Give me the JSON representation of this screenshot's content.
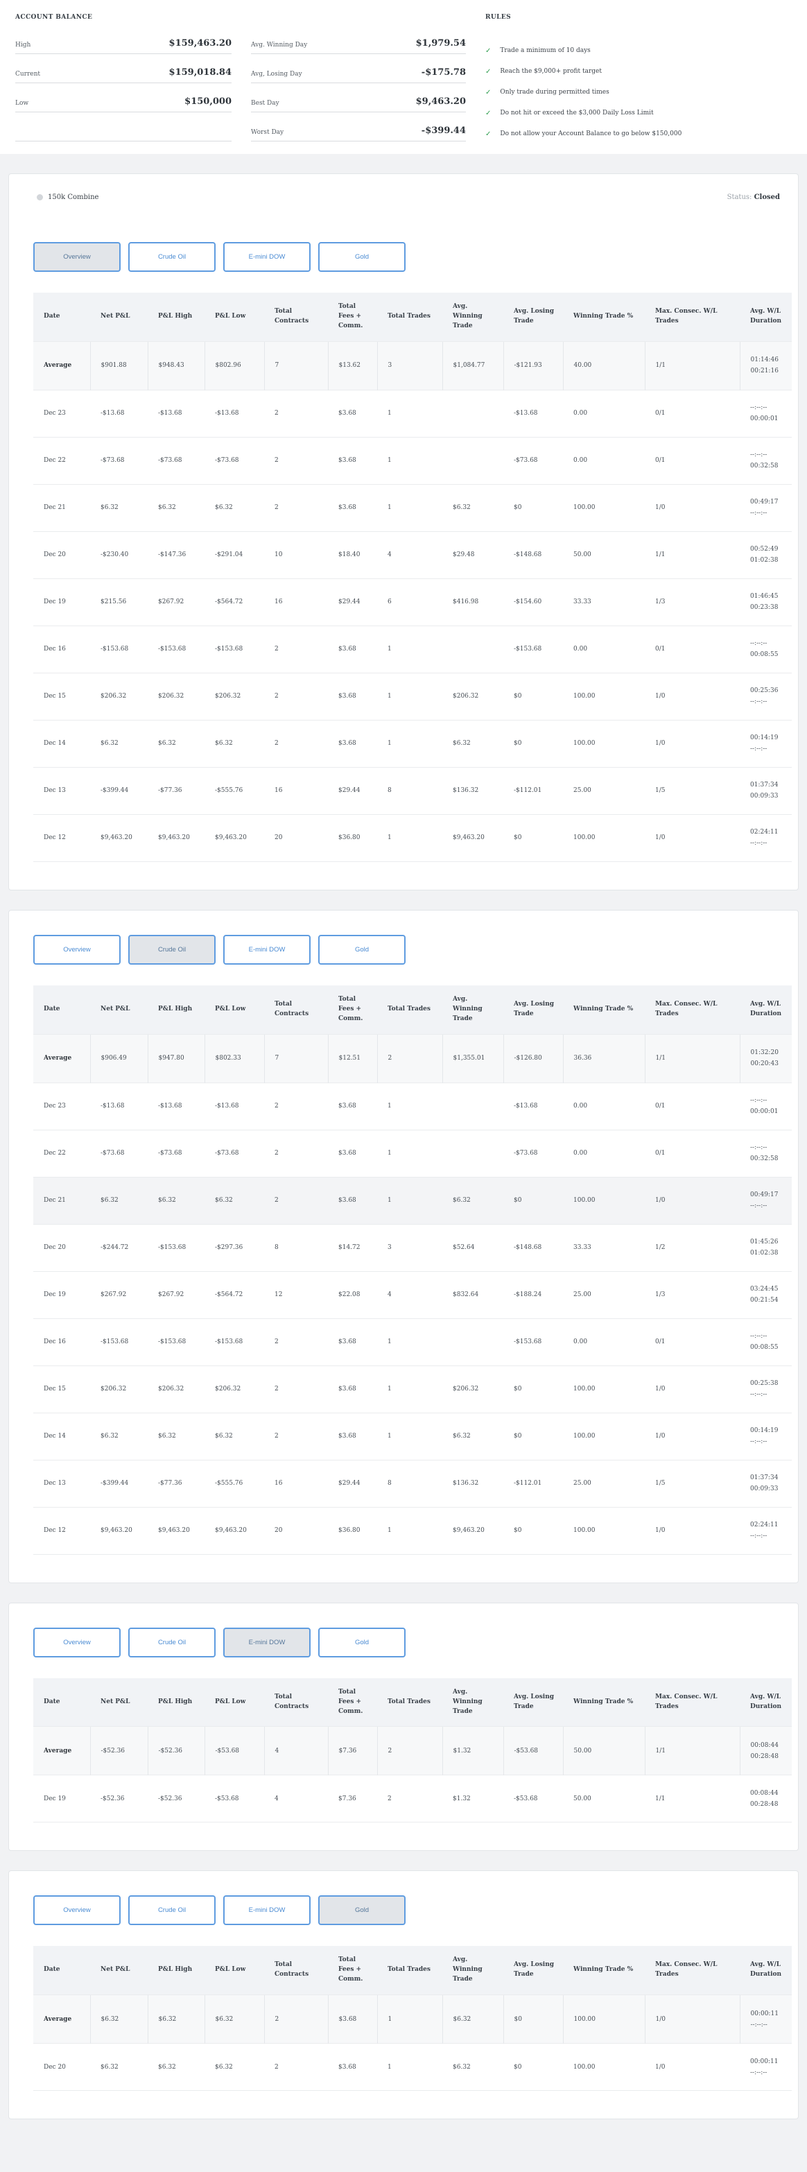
{
  "colors": {
    "accent_blue": "#5f9ce0",
    "check_green": "#2f9e4f",
    "header_bg": "#f1f3f6"
  },
  "icons": {
    "check": "✓",
    "status_dot": "gray-circle"
  },
  "top": {
    "account_balance": {
      "title": "ACCOUNT BALANCE",
      "rows": [
        {
          "label": "High",
          "value": "$159,463.20"
        },
        {
          "label": "Current",
          "value": "$159,018.84"
        },
        {
          "label": "Low",
          "value": "$150,000"
        },
        {
          "label": "",
          "value": ""
        }
      ]
    },
    "day_stats": [
      {
        "label": "Avg. Winning Day",
        "value": "$1,979.54"
      },
      {
        "label": "Avg, Losing Day",
        "value": "-$175.78"
      },
      {
        "label": "Best Day",
        "value": "$9,463.20"
      },
      {
        "label": "Worst Day",
        "value": "-$399.44"
      }
    ],
    "rules": {
      "title": "RULES",
      "items": [
        "Trade a minimum of 10 days",
        "Reach the $9,000+ profit target",
        "Only trade during permitted times",
        "Do not hit or exceed the $3,000 Daily Loss Limit",
        "Do not allow your Account Balance to go below $150,000"
      ]
    }
  },
  "shared": {
    "columns": [
      "Date",
      "Net P&L",
      "P&L High",
      "P&L Low",
      "Total Contracts",
      "Total Fees + Comm.",
      "Total Trades",
      "Avg. Winning Trade",
      "Avg. Losing Trade",
      "Winning Trade %",
      "Max. Consec. W/L Trades",
      "Avg. W/L Duration"
    ]
  },
  "cards": [
    {
      "header": {
        "title": "150k Combine",
        "status_label": "Status:",
        "status_value": "Closed"
      },
      "tabs": [
        {
          "label": "Overview",
          "active": true
        },
        {
          "label": "Crude Oil",
          "active": false
        },
        {
          "label": "E-mini DOW",
          "active": false
        },
        {
          "label": "Gold",
          "active": false
        }
      ],
      "rows": [
        {
          "is_avg": true,
          "date": "Average",
          "net": "$901.88",
          "high": "$948.43",
          "low": "$802.96",
          "contracts": "7",
          "fees": "$13.62",
          "trades": "3",
          "avg_win": "$1,084.77",
          "avg_loss": "-$121.93",
          "win_pct": "40.00",
          "consec": "1/1",
          "dur_win": "01:14:46",
          "dur_loss": "00:21:16"
        },
        {
          "date": "Dec 23",
          "net": "-$13.68",
          "high": "-$13.68",
          "low": "-$13.68",
          "contracts": "2",
          "fees": "$3.68",
          "trades": "1",
          "avg_win": "",
          "avg_loss": "-$13.68",
          "win_pct": "0.00",
          "consec": "0/1",
          "dur_win": "--:--:--",
          "dur_loss": "00:00:01"
        },
        {
          "date": "Dec 22",
          "net": "-$73.68",
          "high": "-$73.68",
          "low": "-$73.68",
          "contracts": "2",
          "fees": "$3.68",
          "trades": "1",
          "avg_win": "",
          "avg_loss": "-$73.68",
          "win_pct": "0.00",
          "consec": "0/1",
          "dur_win": "--:--:--",
          "dur_loss": "00:32:58"
        },
        {
          "date": "Dec 21",
          "net": "$6.32",
          "high": "$6.32",
          "low": "$6.32",
          "contracts": "2",
          "fees": "$3.68",
          "trades": "1",
          "avg_win": "$6.32",
          "avg_loss": "$0",
          "win_pct": "100.00",
          "consec": "1/0",
          "dur_win": "00:49:17",
          "dur_loss": "--:--:--"
        },
        {
          "date": "Dec 20",
          "net": "-$230.40",
          "high": "-$147.36",
          "low": "-$291.04",
          "contracts": "10",
          "fees": "$18.40",
          "trades": "4",
          "avg_win": "$29.48",
          "avg_loss": "-$148.68",
          "win_pct": "50.00",
          "consec": "1/1",
          "dur_win": "00:52:49",
          "dur_loss": "01:02:38"
        },
        {
          "date": "Dec 19",
          "net": "$215.56",
          "high": "$267.92",
          "low": "-$564.72",
          "contracts": "16",
          "fees": "$29.44",
          "trades": "6",
          "avg_win": "$416.98",
          "avg_loss": "-$154.60",
          "win_pct": "33.33",
          "consec": "1/3",
          "dur_win": "01:46:45",
          "dur_loss": "00:23:38"
        },
        {
          "date": "Dec 16",
          "net": "-$153.68",
          "high": "-$153.68",
          "low": "-$153.68",
          "contracts": "2",
          "fees": "$3.68",
          "trades": "1",
          "avg_win": "",
          "avg_loss": "-$153.68",
          "win_pct": "0.00",
          "consec": "0/1",
          "dur_win": "--:--:--",
          "dur_loss": "00:08:55"
        },
        {
          "date": "Dec 15",
          "net": "$206.32",
          "high": "$206.32",
          "low": "$206.32",
          "contracts": "2",
          "fees": "$3.68",
          "trades": "1",
          "avg_win": "$206.32",
          "avg_loss": "$0",
          "win_pct": "100.00",
          "consec": "1/0",
          "dur_win": "00:25:36",
          "dur_loss": "--:--:--"
        },
        {
          "date": "Dec 14",
          "net": "$6.32",
          "high": "$6.32",
          "low": "$6.32",
          "contracts": "2",
          "fees": "$3.68",
          "trades": "1",
          "avg_win": "$6.32",
          "avg_loss": "$0",
          "win_pct": "100.00",
          "consec": "1/0",
          "dur_win": "00:14:19",
          "dur_loss": "--:--:--"
        },
        {
          "date": "Dec 13",
          "net": "-$399.44",
          "high": "-$77.36",
          "low": "-$555.76",
          "contracts": "16",
          "fees": "$29.44",
          "trades": "8",
          "avg_win": "$136.32",
          "avg_loss": "-$112.01",
          "win_pct": "25.00",
          "consec": "1/5",
          "dur_win": "01:37:34",
          "dur_loss": "00:09:33"
        },
        {
          "date": "Dec 12",
          "net": "$9,463.20",
          "high": "$9,463.20",
          "low": "$9,463.20",
          "contracts": "20",
          "fees": "$36.80",
          "trades": "1",
          "avg_win": "$9,463.20",
          "avg_loss": "$0",
          "win_pct": "100.00",
          "consec": "1/0",
          "dur_win": "02:24:11",
          "dur_loss": "--:--:--"
        }
      ]
    },
    {
      "tabs": [
        {
          "label": "Overview",
          "active": false
        },
        {
          "label": "Crude Oil",
          "active": true
        },
        {
          "label": "E-mini DOW",
          "active": false
        },
        {
          "label": "Gold",
          "active": false
        }
      ],
      "rows": [
        {
          "is_avg": true,
          "date": "Average",
          "net": "$906.49",
          "high": "$947.80",
          "low": "$802.33",
          "contracts": "7",
          "fees": "$12.51",
          "trades": "2",
          "avg_win": "$1,355.01",
          "avg_loss": "-$126.80",
          "win_pct": "36.36",
          "consec": "1/1",
          "dur_win": "01:32:20",
          "dur_loss": "00:20:43"
        },
        {
          "date": "Dec 23",
          "net": "-$13.68",
          "high": "-$13.68",
          "low": "-$13.68",
          "contracts": "2",
          "fees": "$3.68",
          "trades": "1",
          "avg_win": "",
          "avg_loss": "-$13.68",
          "win_pct": "0.00",
          "consec": "0/1",
          "dur_win": "--:--:--",
          "dur_loss": "00:00:01"
        },
        {
          "date": "Dec 22",
          "net": "-$73.68",
          "high": "-$73.68",
          "low": "-$73.68",
          "contracts": "2",
          "fees": "$3.68",
          "trades": "1",
          "avg_win": "",
          "avg_loss": "-$73.68",
          "win_pct": "0.00",
          "consec": "0/1",
          "dur_win": "--:--:--",
          "dur_loss": "00:32:58"
        },
        {
          "is_hl": true,
          "date": "Dec 21",
          "net": "$6.32",
          "high": "$6.32",
          "low": "$6.32",
          "contracts": "2",
          "fees": "$3.68",
          "trades": "1",
          "avg_win": "$6.32",
          "avg_loss": "$0",
          "win_pct": "100.00",
          "consec": "1/0",
          "dur_win": "00:49:17",
          "dur_loss": "--:--:--"
        },
        {
          "date": "Dec 20",
          "net": "-$244.72",
          "high": "-$153.68",
          "low": "-$297.36",
          "contracts": "8",
          "fees": "$14.72",
          "trades": "3",
          "avg_win": "$52.64",
          "avg_loss": "-$148.68",
          "win_pct": "33.33",
          "consec": "1/2",
          "dur_win": "01:45:26",
          "dur_loss": "01:02:38"
        },
        {
          "date": "Dec 19",
          "net": "$267.92",
          "high": "$267.92",
          "low": "-$564.72",
          "contracts": "12",
          "fees": "$22.08",
          "trades": "4",
          "avg_win": "$832.64",
          "avg_loss": "-$188.24",
          "win_pct": "25.00",
          "consec": "1/3",
          "dur_win": "03:24:45",
          "dur_loss": "00:21:54"
        },
        {
          "date": "Dec 16",
          "net": "-$153.68",
          "high": "-$153.68",
          "low": "-$153.68",
          "contracts": "2",
          "fees": "$3.68",
          "trades": "1",
          "avg_win": "",
          "avg_loss": "-$153.68",
          "win_pct": "0.00",
          "consec": "0/1",
          "dur_win": "--:--:--",
          "dur_loss": "00:08:55"
        },
        {
          "date": "Dec 15",
          "net": "$206.32",
          "high": "$206.32",
          "low": "$206.32",
          "contracts": "2",
          "fees": "$3.68",
          "trades": "1",
          "avg_win": "$206.32",
          "avg_loss": "$0",
          "win_pct": "100.00",
          "consec": "1/0",
          "dur_win": "00:25:38",
          "dur_loss": "--:--:--"
        },
        {
          "date": "Dec 14",
          "net": "$6.32",
          "high": "$6.32",
          "low": "$6.32",
          "contracts": "2",
          "fees": "$3.68",
          "trades": "1",
          "avg_win": "$6.32",
          "avg_loss": "$0",
          "win_pct": "100.00",
          "consec": "1/0",
          "dur_win": "00:14:19",
          "dur_loss": "--:--:--"
        },
        {
          "date": "Dec 13",
          "net": "-$399.44",
          "high": "-$77.36",
          "low": "-$555.76",
          "contracts": "16",
          "fees": "$29.44",
          "trades": "8",
          "avg_win": "$136.32",
          "avg_loss": "-$112.01",
          "win_pct": "25.00",
          "consec": "1/5",
          "dur_win": "01:37:34",
          "dur_loss": "00:09:33"
        },
        {
          "date": "Dec 12",
          "net": "$9,463.20",
          "high": "$9,463.20",
          "low": "$9,463.20",
          "contracts": "20",
          "fees": "$36.80",
          "trades": "1",
          "avg_win": "$9,463.20",
          "avg_loss": "$0",
          "win_pct": "100.00",
          "consec": "1/0",
          "dur_win": "02:24:11",
          "dur_loss": "--:--:--"
        }
      ]
    },
    {
      "tabs": [
        {
          "label": "Overview",
          "active": false
        },
        {
          "label": "Crude Oil",
          "active": false
        },
        {
          "label": "E-mini DOW",
          "active": true
        },
        {
          "label": "Gold",
          "active": false
        }
      ],
      "rows": [
        {
          "is_avg": true,
          "date": "Average",
          "net": "-$52.36",
          "high": "-$52.36",
          "low": "-$53.68",
          "contracts": "4",
          "fees": "$7.36",
          "trades": "2",
          "avg_win": "$1.32",
          "avg_loss": "-$53.68",
          "win_pct": "50.00",
          "consec": "1/1",
          "dur_win": "00:08:44",
          "dur_loss": "00:28:48"
        },
        {
          "date": "Dec 19",
          "net": "-$52.36",
          "high": "-$52.36",
          "low": "-$53.68",
          "contracts": "4",
          "fees": "$7.36",
          "trades": "2",
          "avg_win": "$1.32",
          "avg_loss": "-$53.68",
          "win_pct": "50.00",
          "consec": "1/1",
          "dur_win": "00:08:44",
          "dur_loss": "00:28:48"
        }
      ]
    },
    {
      "tabs": [
        {
          "label": "Overview",
          "active": false
        },
        {
          "label": "Crude Oil",
          "active": false
        },
        {
          "label": "E-mini DOW",
          "active": false
        },
        {
          "label": "Gold",
          "active": true
        }
      ],
      "rows": [
        {
          "is_avg": true,
          "date": "Average",
          "net": "$6.32",
          "high": "$6.32",
          "low": "$6.32",
          "contracts": "2",
          "fees": "$3.68",
          "trades": "1",
          "avg_win": "$6.32",
          "avg_loss": "$0",
          "win_pct": "100.00",
          "consec": "1/0",
          "dur_win": "00:00:11",
          "dur_loss": "--:--:--"
        },
        {
          "date": "Dec 20",
          "net": "$6.32",
          "high": "$6.32",
          "low": "$6.32",
          "contracts": "2",
          "fees": "$3.68",
          "trades": "1",
          "avg_win": "$6.32",
          "avg_loss": "$0",
          "win_pct": "100.00",
          "consec": "1/0",
          "dur_win": "00:00:11",
          "dur_loss": "--:--:--"
        }
      ]
    }
  ]
}
